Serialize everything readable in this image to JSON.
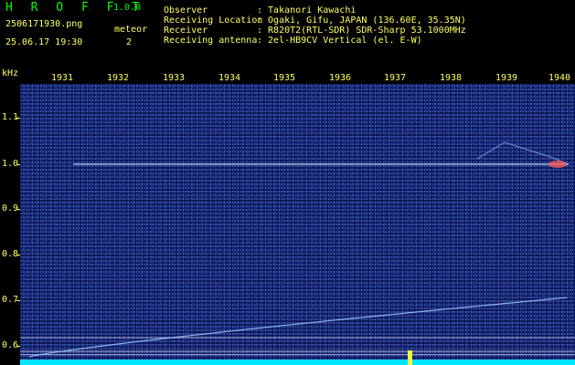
{
  "header": {
    "app_title": "H R O F F T",
    "version": "1.0.0",
    "filename": "2506171930.png",
    "datetime": "25.06.17 19:30",
    "meteor_label": "meteor",
    "meteor_count": "2",
    "info": [
      {
        "key": "Observer",
        "value": ": Takanori Kawachi"
      },
      {
        "key": "Receiving Location",
        "value": ": Ogaki, Gifu, JAPAN (136.60E, 35.35N)"
      },
      {
        "key": "Receiver",
        "value": ": R820T2(RTL-SDR) SDR-Sharp 53.1000MHz"
      },
      {
        "key": "Receiving antenna",
        "value": ": 2el-HB9CV Vertical (el. E-W)"
      }
    ]
  },
  "chart_data": {
    "type": "heatmap",
    "ylabel": "kHz",
    "x_ticks": [
      "1931",
      "1932",
      "1933",
      "1934",
      "1935",
      "1936",
      "1937",
      "1938",
      "1939",
      "1940"
    ],
    "y_ticks": [
      "1.1",
      "1.0",
      "0.9",
      "0.8",
      "0.7",
      "0.6"
    ],
    "ylim": [
      0.58,
      1.15
    ],
    "carrier_khz": 1.0,
    "drifting_signal": {
      "start_khz": 0.58,
      "end_khz": 0.71
    },
    "reference_lines_khz": [
      0.62,
      0.59,
      0.583
    ],
    "colors": {
      "background": "#0b1656",
      "text": "#ffff60",
      "title": "#00ff00",
      "signal": "#cfe8ff",
      "baseline": "#00e5ff"
    }
  }
}
